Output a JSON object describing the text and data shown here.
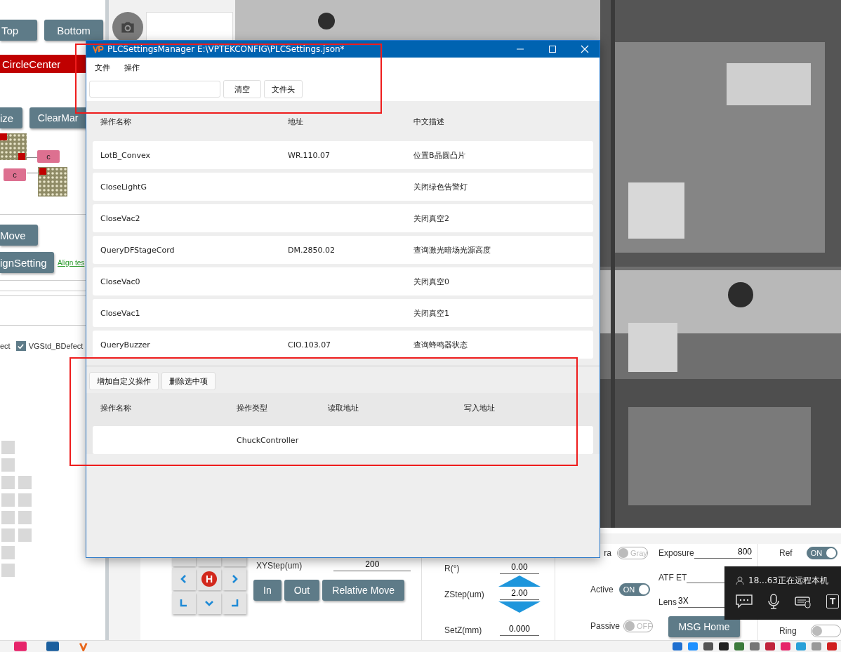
{
  "left_panel": {
    "view_buttons": [
      "Top",
      "Bottom"
    ],
    "circle_center": "CircleCenter",
    "mark_buttons": [
      "ize",
      "ClearMar"
    ],
    "diagram_labels": [
      "c",
      "c"
    ],
    "move_button": "Move",
    "align_button": "ignSetting",
    "align_link": "Align tes",
    "defect_cut": "ect",
    "defect_checkbox": {
      "label": "VGStd_BDefect",
      "checked": true
    }
  },
  "dialog": {
    "title": "PLCSettingsManager E:\\VPTEKCONFIG\\PLCSettings.json*",
    "menu": [
      "文件",
      "操作"
    ],
    "toolbar_buttons": [
      "清空",
      "文件头"
    ],
    "columns": [
      "操作名称",
      "地址",
      "中文描述"
    ],
    "rows": [
      [
        "LotB_Convex",
        "WR.110.07",
        "位置B晶圆凸片"
      ],
      [
        "CloseLightG",
        "",
        "关闭绿色告警灯"
      ],
      [
        "CloseVac2",
        "",
        "关闭真空2"
      ],
      [
        "QueryDFStageCord",
        "DM.2850.02",
        "查询激光暗场光源高度"
      ],
      [
        "CloseVac0",
        "",
        "关闭真空0"
      ],
      [
        "CloseVac1",
        "",
        "关闭真空1"
      ],
      [
        "QueryBuzzer",
        "CIO.103.07",
        "查询蜂鸣器状态"
      ]
    ],
    "custom_buttons": [
      "增加自定义操作",
      "删除选中项"
    ],
    "custom_columns": [
      "操作名称",
      "操作类型",
      "读取地址",
      "写入地址"
    ],
    "custom_rows": [
      [
        "",
        "ChuckController",
        "",
        ""
      ]
    ]
  },
  "stage": {
    "pad_home": "H",
    "xy_step": {
      "label": "XYStep(um)",
      "value": "200"
    },
    "move_buttons": [
      "In",
      "Out",
      "Relative Move"
    ],
    "z_fields": [
      {
        "label": "R(°)",
        "value": "0.00"
      },
      {
        "label": "ZStep(um)",
        "value": "2.00"
      },
      {
        "label": "SetZ(mm)",
        "value": "0.000"
      }
    ]
  },
  "light": {
    "toggles": [
      {
        "label": "ra",
        "text": "Gray",
        "on": false
      },
      {
        "label": "Active",
        "text": "ON",
        "on": true
      },
      {
        "label": "Passive",
        "text": "OFF",
        "on": false
      }
    ]
  },
  "camera": {
    "fields": [
      {
        "label": "Exposure",
        "value": "800"
      },
      {
        "label": "ATF ET"
      },
      {
        "label": "Lens",
        "value": "3X"
      }
    ],
    "home_button": "MSG Home"
  },
  "side_toggles": [
    {
      "label": "Ref",
      "text": "ON",
      "on": true
    },
    {
      "label": "Ring",
      "on": false
    }
  ],
  "remote_toast": {
    "text": "18...63正在远程本机",
    "key_label": "T"
  }
}
